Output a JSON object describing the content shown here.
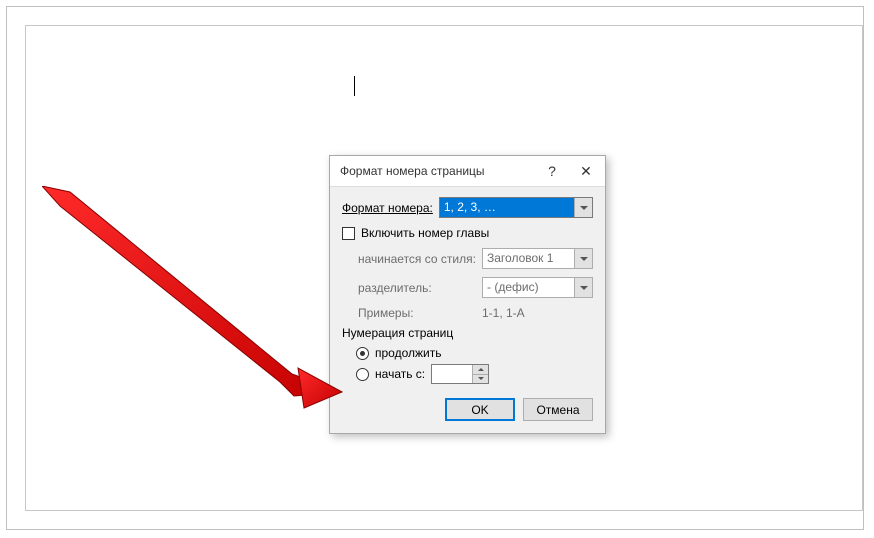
{
  "dialog": {
    "title": "Формат номера страницы",
    "help_tooltip": "?",
    "close_tooltip": "✕",
    "format_label": "Формат номера:",
    "format_value": "1, 2, 3, …",
    "include_chapter_label": "Включить номер главы",
    "include_chapter_checked": false,
    "starts_with_style_label": "начинается со стиля:",
    "starts_with_style_value": "Заголовок 1",
    "separator_label": "разделитель:",
    "separator_value": "-   (дефис)",
    "examples_label": "Примеры:",
    "examples_value": "1-1, 1-A",
    "numbering_group": "Нумерация страниц",
    "continue_label": "продолжить",
    "start_at_label": "начать с:",
    "start_at_value": "",
    "radio_selected": "continue",
    "ok_label": "OK",
    "cancel_label": "Отмена"
  },
  "arrow": {
    "color": "#e21b1b"
  }
}
